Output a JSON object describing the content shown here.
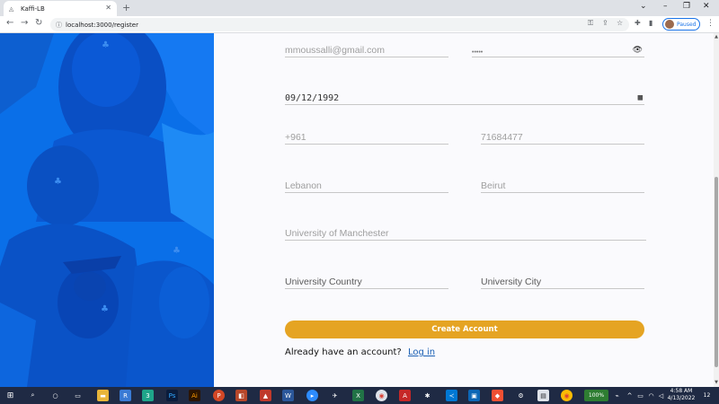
{
  "browser": {
    "tab_title": "Kaffi-LB",
    "url": "localhost:3000/register",
    "profile_status": "Paused"
  },
  "form": {
    "email_placeholder": "mmoussalli@gmail.com",
    "password_mask": "•••••",
    "birthdate_value": "09/12/1992",
    "phone_code_placeholder": "+961",
    "phone_number_placeholder": "71684477",
    "country_placeholder": "Lebanon",
    "city_placeholder": "Beirut",
    "university_placeholder": "University of Manchester",
    "university_country_placeholder": "University Country",
    "university_city_placeholder": "University City",
    "create_account_label": "Create Account",
    "login_prompt": "Already have an account?",
    "login_link_label": "Log in"
  },
  "taskbar": {
    "battery": "100%",
    "time": "4:58 AM",
    "date": "4/13/2022",
    "notification_count": "12"
  },
  "colors": {
    "hero_blue": "#0a6fe8",
    "accent_gold": "#e5a423",
    "link_blue": "#1a5fb4"
  }
}
